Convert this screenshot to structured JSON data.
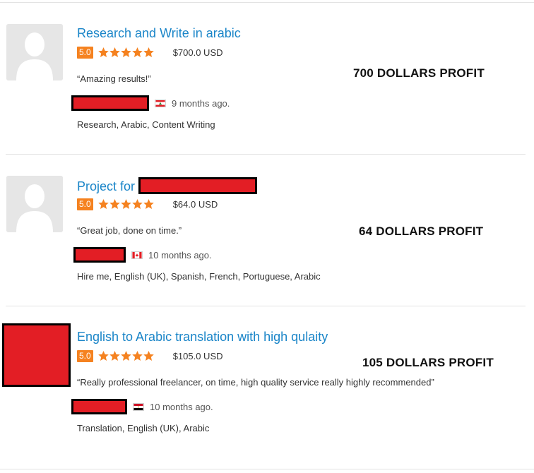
{
  "reviews": [
    {
      "title": "Research and Write in arabic",
      "score": "5.0",
      "stars": 5,
      "amount": "$700.0 USD",
      "comment": "“Amazing results!”",
      "country_flag": "lebanon-flag",
      "time": "9 months ago.",
      "skills": "Research, Arabic, Content Writing",
      "annotation": "700 DOLLARS PROFIT"
    },
    {
      "title": "Project for",
      "score": "5.0",
      "stars": 5,
      "amount": "$64.0 USD",
      "comment": "“Great job, done on time.”",
      "country_flag": "canada-flag",
      "time": "10 months ago.",
      "skills": "Hire me, English (UK), Spanish, French, Portuguese, Arabic",
      "annotation": "64 DOLLARS PROFIT"
    },
    {
      "title": "English to Arabic translation with high qulaity",
      "score": "5.0",
      "stars": 5,
      "amount": "$105.0 USD",
      "comment": "“Really professional freelancer, on time, high quality service really highly recommended”",
      "country_flag": "egypt-flag",
      "time": "10 months ago.",
      "skills": "Translation, English (UK), Arabic",
      "annotation": "105 DOLLARS PROFIT"
    }
  ],
  "colors": {
    "link": "#1a85c8",
    "score_badge": "#f58220",
    "star": "#f58220",
    "redaction": "#e31e25",
    "redaction_border": "#000000"
  }
}
